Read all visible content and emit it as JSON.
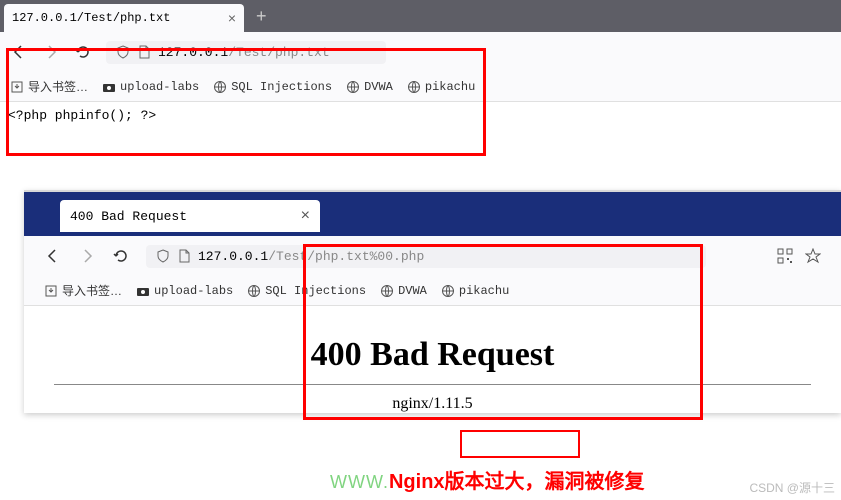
{
  "browser1": {
    "tab_title": "127.0.0.1/Test/php.txt",
    "url_host": "127.0.0.1",
    "url_path": "/Test/php.txt",
    "content": "<?php phpinfo(); ?>"
  },
  "browser2": {
    "tab_title": "400 Bad Request",
    "url_host": "127.0.0.1",
    "url_path": "/Test/php.txt%00.php",
    "heading": "400 Bad Request",
    "server": "nginx/1.11.5"
  },
  "bookmarks": {
    "import": "导入书签…",
    "items": [
      {
        "label": "upload-labs",
        "icon": "camera"
      },
      {
        "label": "SQL Injections",
        "icon": "globe"
      },
      {
        "label": "DVWA",
        "icon": "globe"
      },
      {
        "label": "pikachu",
        "icon": "globe"
      }
    ]
  },
  "annotation": {
    "wm_prefix": "WWW.",
    "text1": "Nginx版本过大，",
    "text2": "漏洞被修复"
  },
  "watermark": "CSDN @源十三"
}
